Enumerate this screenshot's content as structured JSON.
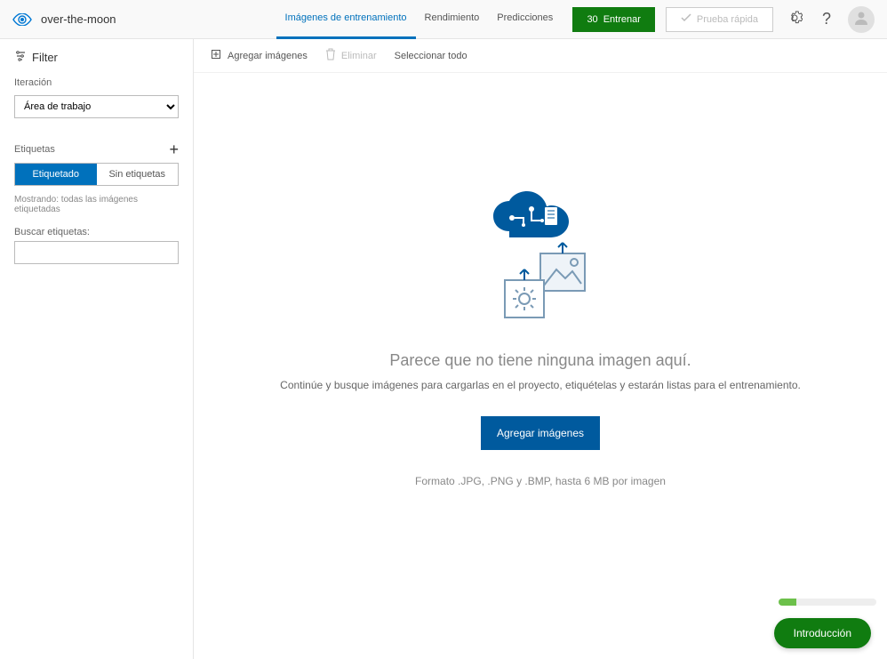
{
  "header": {
    "project_name": "over-the-moon",
    "tabs": {
      "training": "Imágenes de entrenamiento",
      "performance": "Rendimiento",
      "predictions": "Predicciones"
    },
    "train_button_prefix": "30",
    "train_button": "Entrenar",
    "quick_test": "Prueba rápida"
  },
  "sidebar": {
    "filter_label": "Filter",
    "iteration_label": "Iteración",
    "iteration_selected": "Área de trabajo",
    "tags_label": "Etiquetas",
    "tagged_label": "Etiquetado",
    "untagged_label": "Sin etiquetas",
    "showing_text": "Mostrando: todas las imágenes etiquetadas",
    "search_label": "Buscar etiquetas:"
  },
  "toolbar": {
    "add_images": "Agregar imágenes",
    "delete": "Eliminar",
    "select_all": "Seleccionar todo"
  },
  "empty": {
    "title": "Parece que no tiene ninguna imagen aquí.",
    "subtitle": "Continúe y busque imágenes para cargarlas en el proyecto, etiquételas y estarán listas para el entrenamiento.",
    "button": "Agregar imágenes",
    "format": "Formato .JPG, .PNG y .BMP, hasta 6 MB por imagen"
  },
  "intro": {
    "button": "Introducción"
  }
}
